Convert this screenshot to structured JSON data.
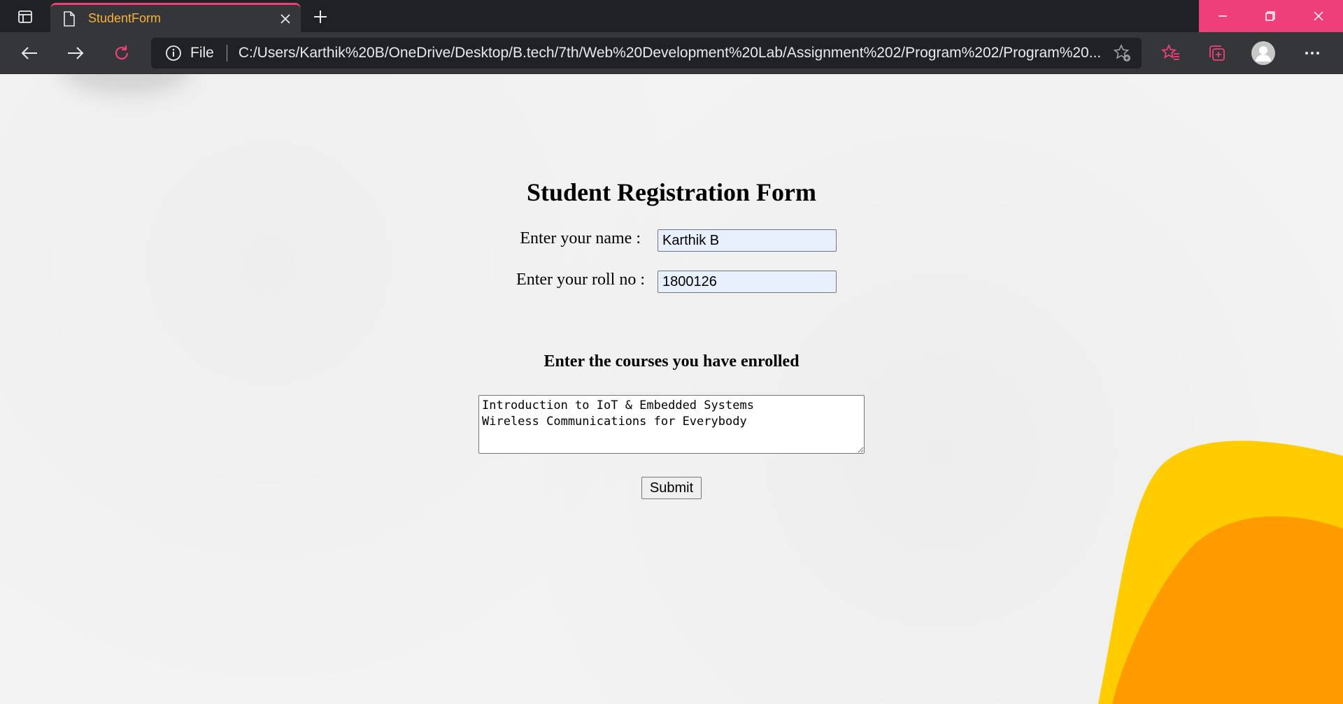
{
  "browser": {
    "tab_title": "StudentForm",
    "address_label": "File",
    "url": "C:/Users/Karthik%20B/OneDrive/Desktop/B.tech/7th/Web%20Development%20Lab/Assignment%202/Program%202/Program%20..."
  },
  "form": {
    "title": "Student Registration Form",
    "name_label": "Enter your name :",
    "name_value": "Karthik B",
    "roll_label": "Enter your roll no :",
    "roll_value": "1800126",
    "courses_heading": "Enter the courses you have enrolled",
    "courses_value": "Introduction to IoT & Embedded Systems\nWireless Communications for Everybody",
    "submit_label": "Submit"
  },
  "colors": {
    "accent": "#ef3f7a",
    "tab_text": "#f6b13b",
    "deco_yellow": "#ffcc00",
    "deco_orange": "#ff9b00"
  },
  "icons": [
    "tab-actions-icon",
    "page-icon",
    "close-icon",
    "plus-icon",
    "minimize-icon",
    "restore-icon",
    "close-window-icon",
    "back-arrow-icon",
    "forward-arrow-icon",
    "reload-icon",
    "info-icon",
    "add-favorite-icon",
    "favorites-icon",
    "collections-icon",
    "profile-icon",
    "more-icon"
  ]
}
